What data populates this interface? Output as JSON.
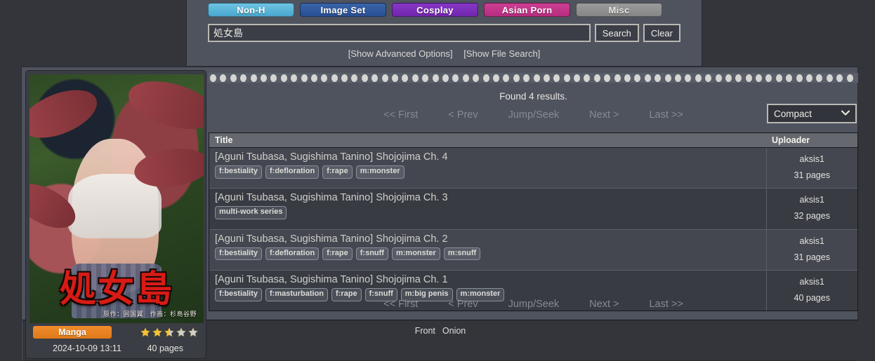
{
  "search": {
    "categories": [
      {
        "label": "Non-H",
        "color": "#49a7cd",
        "name": "non-h"
      },
      {
        "label": "Image Set",
        "color": "#2a4f93",
        "name": "image-set"
      },
      {
        "label": "Cosplay",
        "color": "#7126ae",
        "name": "cosplay"
      },
      {
        "label": "Asian Porn",
        "color": "#b82d80",
        "name": "asian-porn"
      },
      {
        "label": "Misc",
        "color": "#868686",
        "name": "misc"
      }
    ],
    "query": "処女島",
    "placeholder": "",
    "search_button": "Search",
    "clear_button": "Clear",
    "advanced_options_link": "[Show Advanced Options]",
    "file_search_link": "[Show File Search]"
  },
  "results": {
    "found_text": "Found 4 results.",
    "view_mode": "Compact",
    "chevron": "❯",
    "pager": {
      "first": "<< First",
      "prev": "< Prev",
      "jump": "Jump/Seek",
      "next": "Next >",
      "last": "Last >>"
    },
    "columns": {
      "title": "Title",
      "uploader": "Uploader"
    },
    "rows": [
      {
        "title": "[Aguni Tsubasa, Sugishima Tanino] Shojojima Ch. 4",
        "tags": [
          "f:bestiality",
          "f:defloration",
          "f:rape",
          "m:monster"
        ],
        "uploader": "aksis1",
        "pages": "31 pages"
      },
      {
        "title": "[Aguni Tsubasa, Sugishima Tanino] Shojojima Ch. 3",
        "tags": [
          "multi-work series"
        ],
        "uploader": "aksis1",
        "pages": "32 pages"
      },
      {
        "title": "[Aguni Tsubasa, Sugishima Tanino] Shojojima Ch. 2",
        "tags": [
          "f:bestiality",
          "f:defloration",
          "f:rape",
          "f:snuff",
          "m:monster",
          "m:snuff"
        ],
        "uploader": "aksis1",
        "pages": "31 pages"
      },
      {
        "title": "[Aguni Tsubasa, Sugishima Tanino] Shojojima Ch. 1",
        "tags": [
          "f:bestiality",
          "f:masturbation",
          "f:rape",
          "f:snuff",
          "m:big penis",
          "m:monster"
        ],
        "uploader": "aksis1",
        "pages": "40 pages"
      }
    ]
  },
  "footer": {
    "links": [
      "Front",
      "Onion"
    ]
  },
  "card": {
    "cover_title": "処女島",
    "cover_credit": "原作：囲国翼　作画：杉島谷野",
    "category_badge": "Manga",
    "rating_filled": 2.5,
    "rating_max": 5,
    "date": "2024-10-09 13:11",
    "pages": "40 pages",
    "badge_color": "#e07a18",
    "star_color": "#f5c33b"
  }
}
